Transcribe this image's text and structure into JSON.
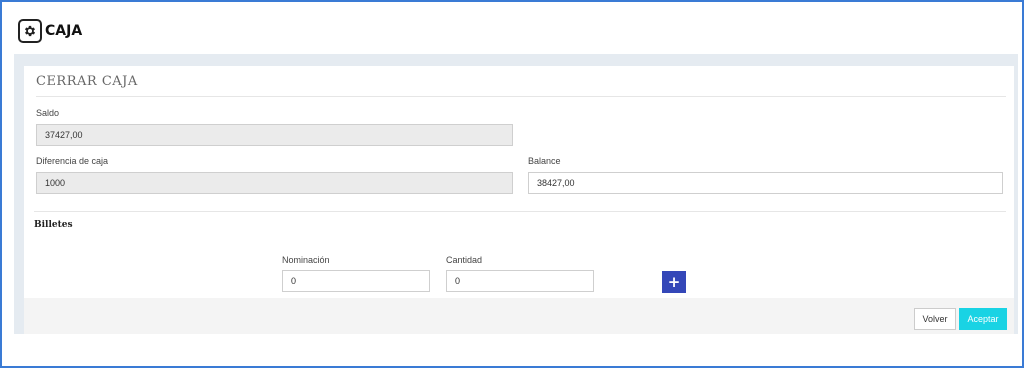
{
  "header": {
    "title": "CAJA",
    "icon": "gear-icon"
  },
  "panel": {
    "title": "CERRAR CAJA"
  },
  "form": {
    "saldo_label": "Saldo",
    "saldo_value": "37427,00",
    "diferencia_label": "Diferencia de caja",
    "diferencia_value": "1000",
    "balance_label": "Balance",
    "balance_value": "38427,00"
  },
  "billetes": {
    "title": "Billetes",
    "nominacion_label": "Nominación",
    "nominacion_value": "0",
    "cantidad_label": "Cantidad",
    "cantidad_value": "0",
    "add_label": "+"
  },
  "footer": {
    "volver_label": "Volver",
    "aceptar_label": "Aceptar"
  },
  "colors": {
    "accent": "#19d3e4",
    "add_button": "#3447b8",
    "frame": "#3a7bd5"
  }
}
